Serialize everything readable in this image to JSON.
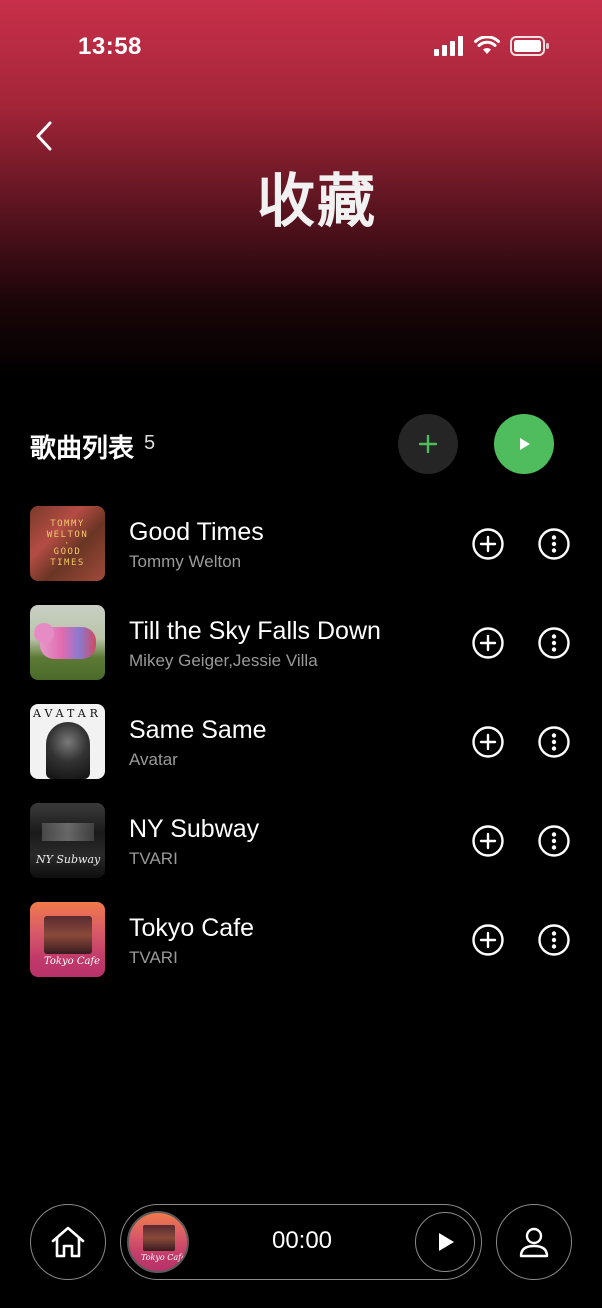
{
  "status_bar": {
    "time": "13:58"
  },
  "header": {
    "title": "收藏"
  },
  "section": {
    "label": "歌曲列表",
    "count": "5"
  },
  "songs": [
    {
      "title": "Good Times",
      "artist": "Tommy Welton",
      "cover_text": [
        "TOMMY",
        "WELTON",
        "GOOD",
        "TIMES"
      ]
    },
    {
      "title": "Till the Sky Falls Down",
      "artist": "Mikey Geiger,Jessie Villa"
    },
    {
      "title": "Same Same",
      "artist": "Avatar",
      "cover_text": "AVATAR"
    },
    {
      "title": "NY Subway",
      "artist": "TVARI",
      "cover_text": "NY Subway"
    },
    {
      "title": "Tokyo Cafe",
      "artist": "TVARI",
      "cover_text": "Tokyo Cafe"
    }
  ],
  "player": {
    "time": "00:00",
    "cover_text": "Tokyo Cafe"
  },
  "colors": {
    "header_gradient_top": "#c8304a",
    "accent_green": "#4fbd5e",
    "background": "#000000",
    "muted_text": "#9a9a9a"
  },
  "icons": {
    "back": "chevron-left-icon",
    "add_all": "plus-icon",
    "play_all": "play-icon",
    "row_add": "circle-plus-icon",
    "row_more": "circle-more-icon",
    "home": "home-icon",
    "profile": "user-icon"
  }
}
